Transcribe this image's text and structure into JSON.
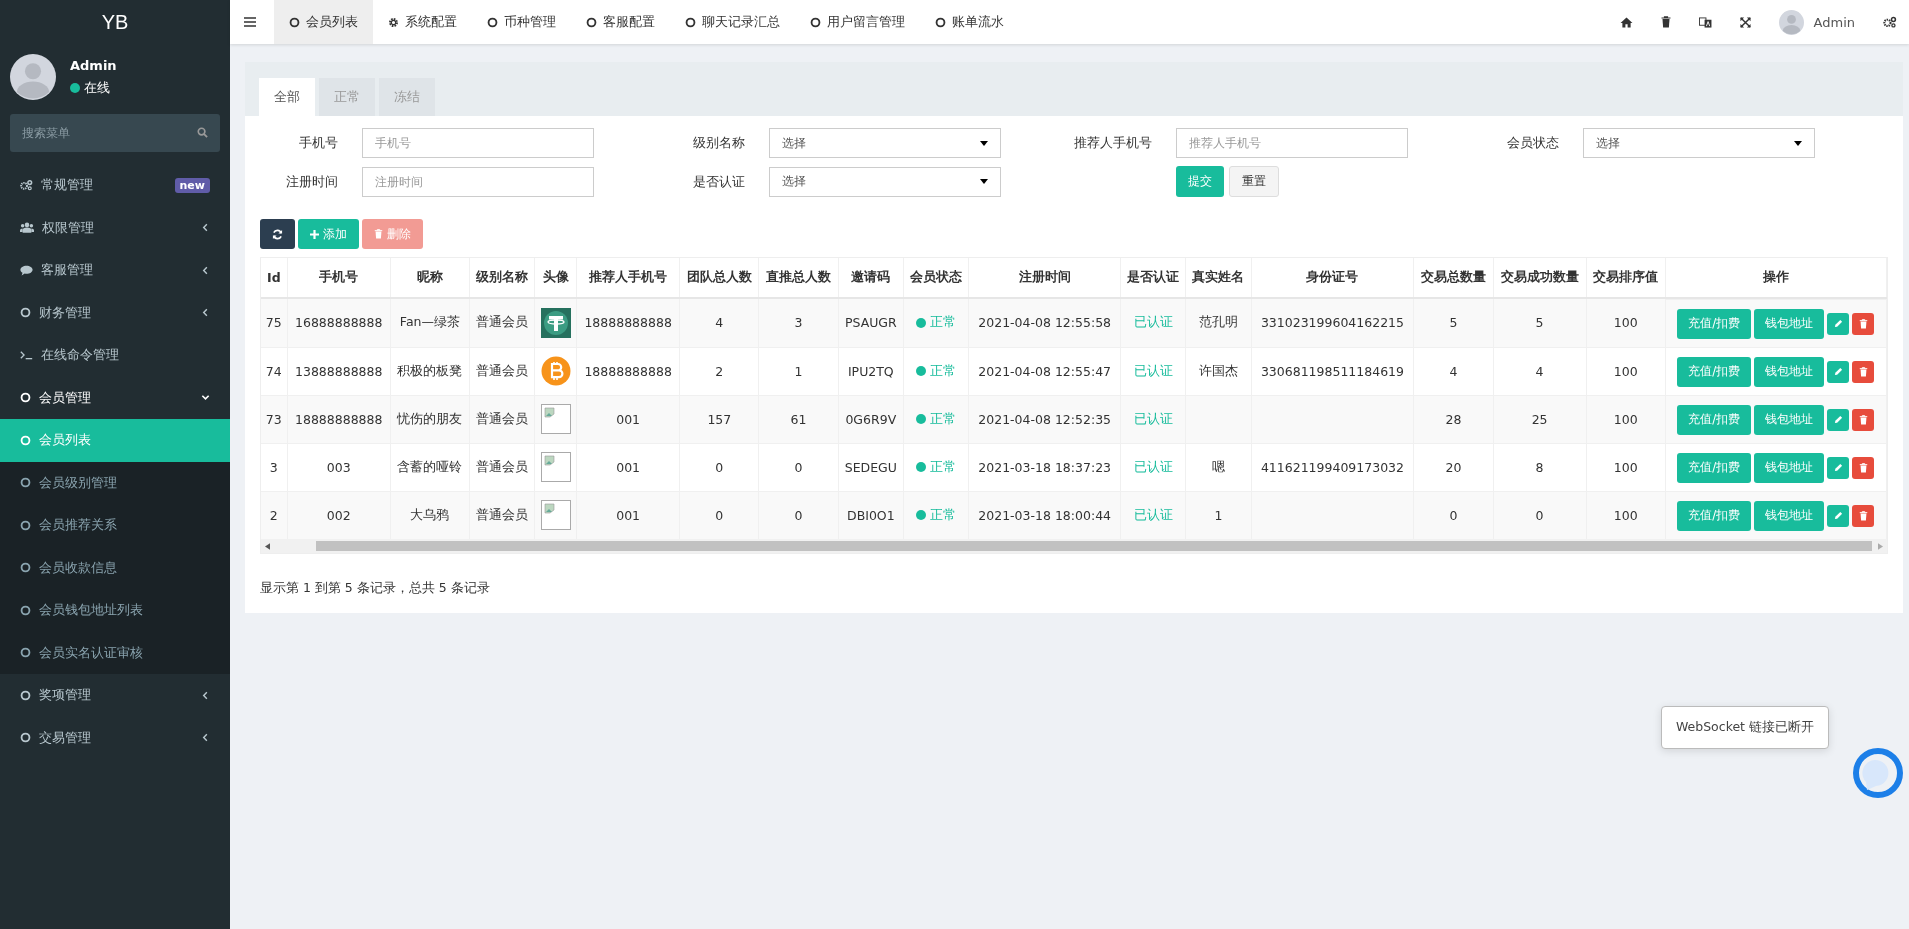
{
  "sidebar": {
    "logo": "YB",
    "user": {
      "name": "Admin",
      "status": "在线"
    },
    "search": {
      "placeholder": "搜索菜单"
    },
    "items": [
      {
        "kind": "gears",
        "label": "常规管理",
        "badge": "new",
        "selected": false
      },
      {
        "kind": "users",
        "label": "权限管理",
        "expanded": false,
        "selected": false
      },
      {
        "kind": "comment",
        "label": "客服管理",
        "expanded": false,
        "selected": false
      },
      {
        "kind": "circle",
        "label": "财务管理",
        "expanded": false,
        "selected": false
      },
      {
        "kind": "terminal",
        "label": "在线命令管理",
        "selected": false
      },
      {
        "kind": "circle",
        "label": "会员管理",
        "expanded": true,
        "selected": false,
        "children": [
          {
            "label": "会员列表",
            "selected": true
          },
          {
            "label": "会员级别管理",
            "selected": false
          },
          {
            "label": "会员推荐关系",
            "selected": false
          },
          {
            "label": "会员收款信息",
            "selected": false
          },
          {
            "label": "会员钱包地址列表",
            "selected": false
          },
          {
            "label": "会员实名认证审核",
            "selected": false
          }
        ]
      },
      {
        "kind": "circle",
        "label": "奖项管理",
        "expanded": false,
        "selected": false
      },
      {
        "kind": "circle",
        "label": "交易管理",
        "expanded": false,
        "selected": false
      }
    ]
  },
  "top_tabs": [
    {
      "kind": "circle",
      "label": "会员列表",
      "selected": true
    },
    {
      "kind": "gear",
      "label": "系统配置",
      "selected": false
    },
    {
      "kind": "circle",
      "label": "币种管理",
      "selected": false
    },
    {
      "kind": "circle",
      "label": "客服配置",
      "selected": false
    },
    {
      "kind": "circle",
      "label": "聊天记录汇总",
      "selected": false
    },
    {
      "kind": "circle",
      "label": "用户留言管理",
      "selected": false
    },
    {
      "kind": "circle",
      "label": "账单流水",
      "selected": false
    }
  ],
  "top_user": "Admin",
  "filter_tabs": [
    {
      "label": "全部",
      "selected": true
    },
    {
      "label": "正常",
      "selected": false
    },
    {
      "label": "冻结",
      "selected": false
    }
  ],
  "filters": [
    {
      "kind": "input",
      "label": "手机号",
      "placeholder": "手机号"
    },
    {
      "kind": "select",
      "label": "级别名称",
      "value": "选择"
    },
    {
      "kind": "input",
      "label": "推荐人手机号",
      "placeholder": "推荐人手机号"
    },
    {
      "kind": "select",
      "label": "会员状态",
      "value": "选择"
    },
    {
      "kind": "input",
      "label": "注册时间",
      "placeholder": "注册时间"
    },
    {
      "kind": "select",
      "label": "是否认证",
      "value": "选择"
    }
  ],
  "filter_buttons": [
    "提交",
    "重置"
  ],
  "toolbar": {
    "add": "添加",
    "delete": "删除"
  },
  "table": {
    "columns": [
      "Id",
      "手机号",
      "昵称",
      "级别名称",
      "头像",
      "推荐人手机号",
      "团队总人数",
      "直推总人数",
      "邀请码",
      "会员状态",
      "注册时间",
      "是否认证",
      "真实姓名",
      "身份证号",
      "交易总数量",
      "交易成功数量",
      "交易排序值",
      "操作"
    ],
    "rows": [
      {
        "id": "75",
        "phone": "16888888888",
        "nickname": "Fan—绿茶",
        "level": "普通会员",
        "avatar": {
          "kind": "tether"
        },
        "referrer": "18888888888",
        "team": "4",
        "direct": "3",
        "code": "PSAUGR",
        "status": "正常",
        "registered": "2021-04-08 12:55:58",
        "verified": "已认证",
        "real_name": "范孔明",
        "id_number": "331023199604162215",
        "trades": "5",
        "success": "5",
        "sort": "100",
        "actions": [
          "充值/扣费",
          "钱包地址"
        ]
      },
      {
        "id": "74",
        "phone": "13888888888",
        "nickname": "积极的板凳",
        "level": "普通会员",
        "avatar": {
          "kind": "bitcoin"
        },
        "referrer": "18888888888",
        "team": "2",
        "direct": "1",
        "code": "IPU2TQ",
        "status": "正常",
        "registered": "2021-04-08 12:55:47",
        "verified": "已认证",
        "real_name": "许国杰",
        "id_number": "330681198511184619",
        "trades": "4",
        "success": "4",
        "sort": "100",
        "actions": [
          "充值/扣费",
          "钱包地址"
        ]
      },
      {
        "id": "73",
        "phone": "18888888888",
        "nickname": "忧伤的朋友",
        "level": "普通会员",
        "avatar": {
          "kind": "broken"
        },
        "referrer": "001",
        "team": "157",
        "direct": "61",
        "code": "0G6R9V",
        "status": "正常",
        "registered": "2021-04-08 12:52:35",
        "verified": "已认证",
        "trades": "28",
        "success": "25",
        "sort": "100",
        "actions": [
          "充值/扣费",
          "钱包地址"
        ]
      },
      {
        "id": "3",
        "phone": "003",
        "nickname": "含蓄的哑铃",
        "level": "普通会员",
        "avatar": {
          "kind": "broken"
        },
        "referrer": "001",
        "team": "0",
        "direct": "0",
        "code": "SEDEGU",
        "status": "正常",
        "registered": "2021-03-18 18:37:23",
        "verified": "已认证",
        "real_name": "嗯",
        "id_number": "411621199409173032",
        "trades": "20",
        "success": "8",
        "sort": "100",
        "actions": [
          "充值/扣费",
          "钱包地址"
        ]
      },
      {
        "id": "2",
        "phone": "002",
        "nickname": "大乌鸦",
        "level": "普通会员",
        "avatar": {
          "kind": "broken"
        },
        "referrer": "001",
        "team": "0",
        "direct": "0",
        "code": "DBI0O1",
        "status": "正常",
        "registered": "2021-03-18 18:00:44",
        "verified": "已认证",
        "real_name": "1",
        "trades": "0",
        "success": "0",
        "sort": "100",
        "actions": [
          "充值/扣费",
          "钱包地址"
        ]
      }
    ]
  },
  "footer": "显示第 1 到第 5 条记录，总共 5 条记录",
  "toast": "WebSocket 链接已断开"
}
